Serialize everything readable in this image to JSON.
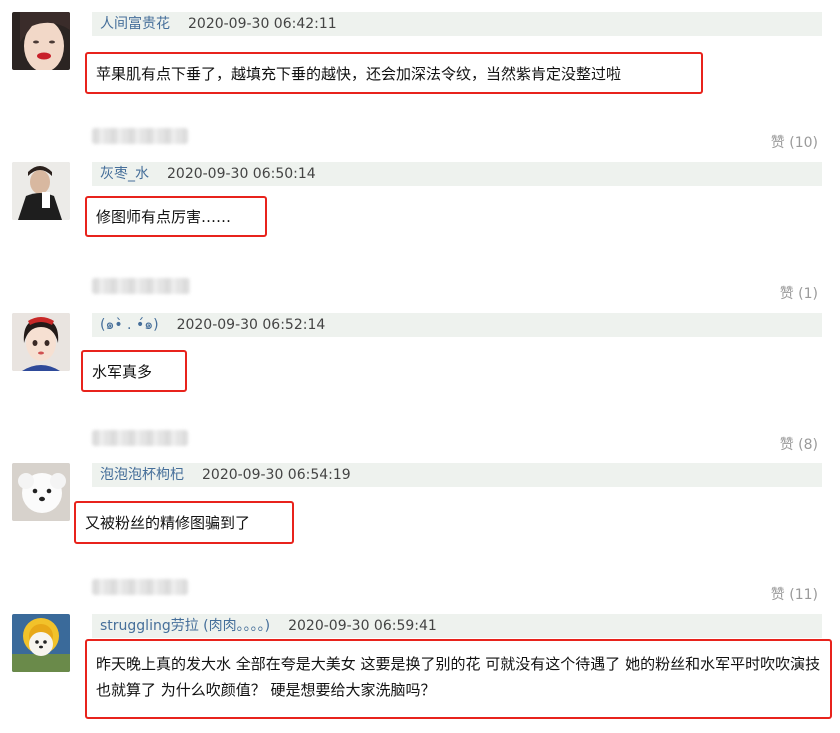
{
  "comments": [
    {
      "username": "人间富贵花",
      "time": "2020-09-30 06:42:11",
      "text": "苹果肌有点下垂了，越填充下垂的越快，还会加深法令纹，当然紫肯定没整过啦",
      "likes": "赞 (10)"
    },
    {
      "username": "灰枣_水",
      "time": "2020-09-30 06:50:14",
      "text": "修图师有点厉害……",
      "likes": "赞 (1)"
    },
    {
      "username": "(๑•̀ . •́๑)",
      "time": "2020-09-30 06:52:14",
      "text": "水军真多",
      "likes": "赞 (8)"
    },
    {
      "username": "泡泡泡杯枸杞",
      "time": "2020-09-30 06:54:19",
      "text": "又被粉丝的精修图骗到了",
      "likes": "赞 (11)"
    },
    {
      "username": "struggling劳拉 (肉肉。。。。)",
      "time": "2020-09-30 06:59:41",
      "text": "昨天晚上真的发大水 全部在夸是大美女 这要是换了别的花 可就没有这个待遇了 她的粉丝和水军平时吹吹演技也就算了 为什么吹颜值？ 硬是想要给大家洗脑吗？"
    }
  ],
  "icons": {
    "avatar1": "avatar-woman-red-lips-icon",
    "avatar2": "avatar-man-portrait-icon",
    "avatar3": "avatar-cartoon-girl-icon",
    "avatar4": "avatar-white-dog-icon",
    "avatar5": "avatar-sunflower-dog-icon"
  },
  "colors": {
    "highlight_border": "#e8231c",
    "username": "#466f9a",
    "header_bg": "#eef2ee"
  }
}
